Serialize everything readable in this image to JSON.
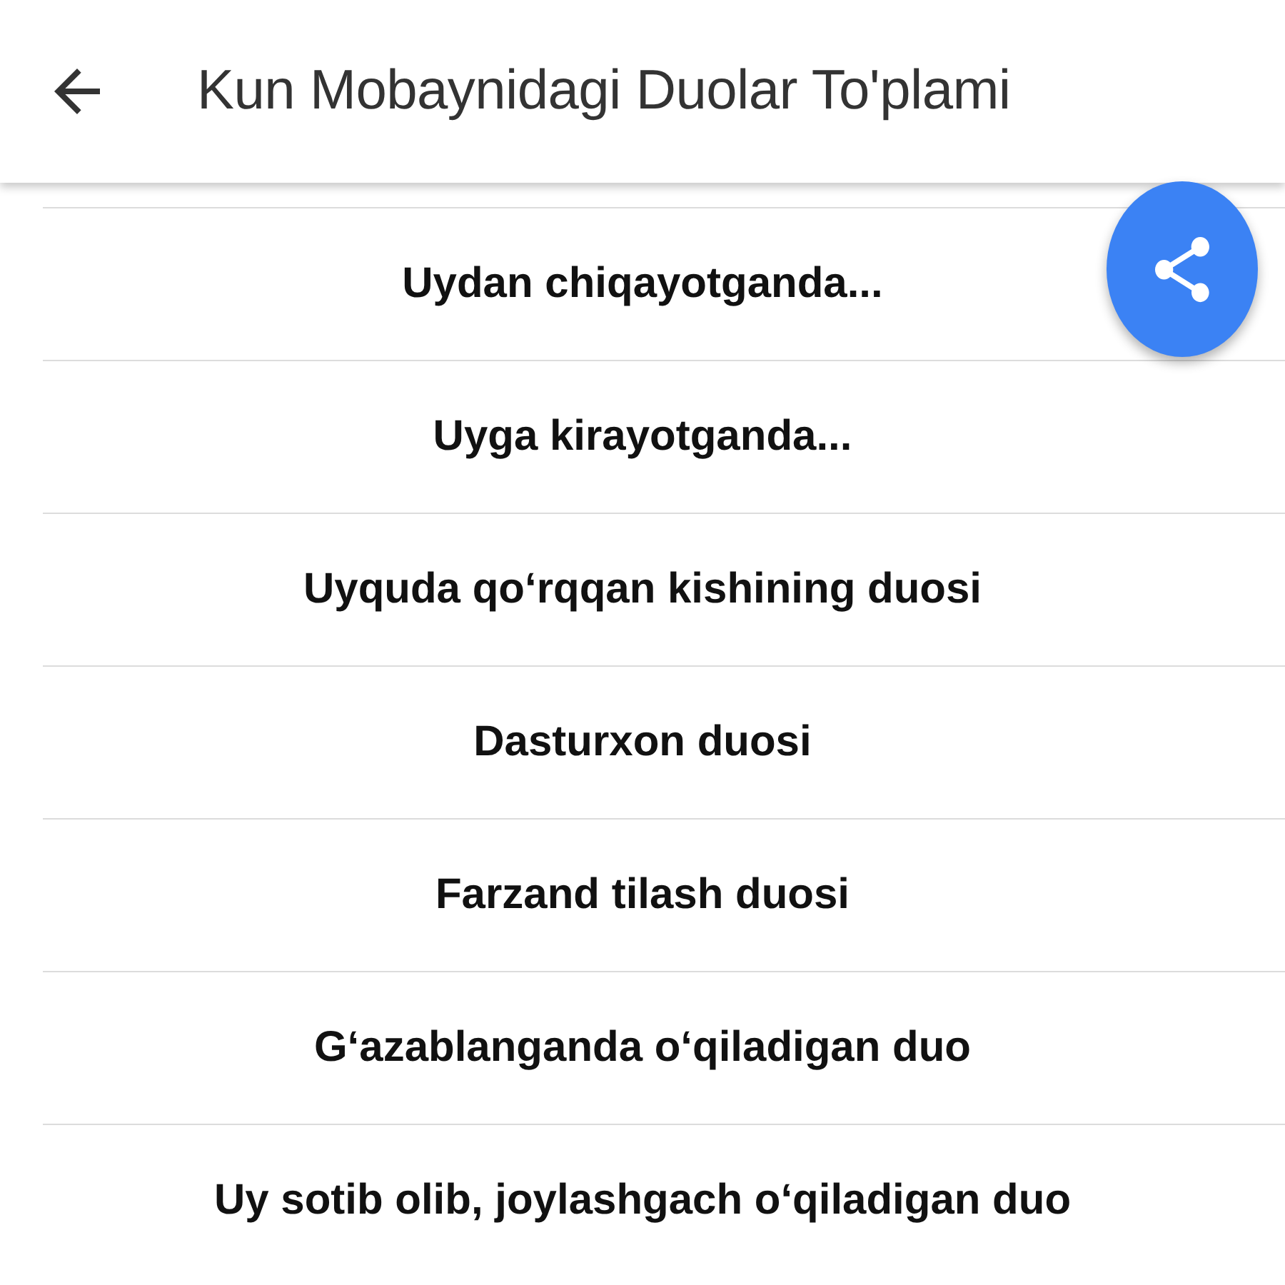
{
  "app_bar": {
    "title": "Kun Mobaynidagi Duolar To'plami"
  },
  "items": [
    {
      "label": "Uydan chiqayotganda..."
    },
    {
      "label": "Uyga kirayotganda..."
    },
    {
      "label": "Uyquda qo‘rqqan kishining duosi"
    },
    {
      "label": "Dasturxon duosi"
    },
    {
      "label": "Farzand tilash duosi"
    },
    {
      "label": "G‘azablanganda o‘qiladigan duo"
    },
    {
      "label": "Uy sotib olib, joylashgach o‘qiladigan duo"
    }
  ]
}
